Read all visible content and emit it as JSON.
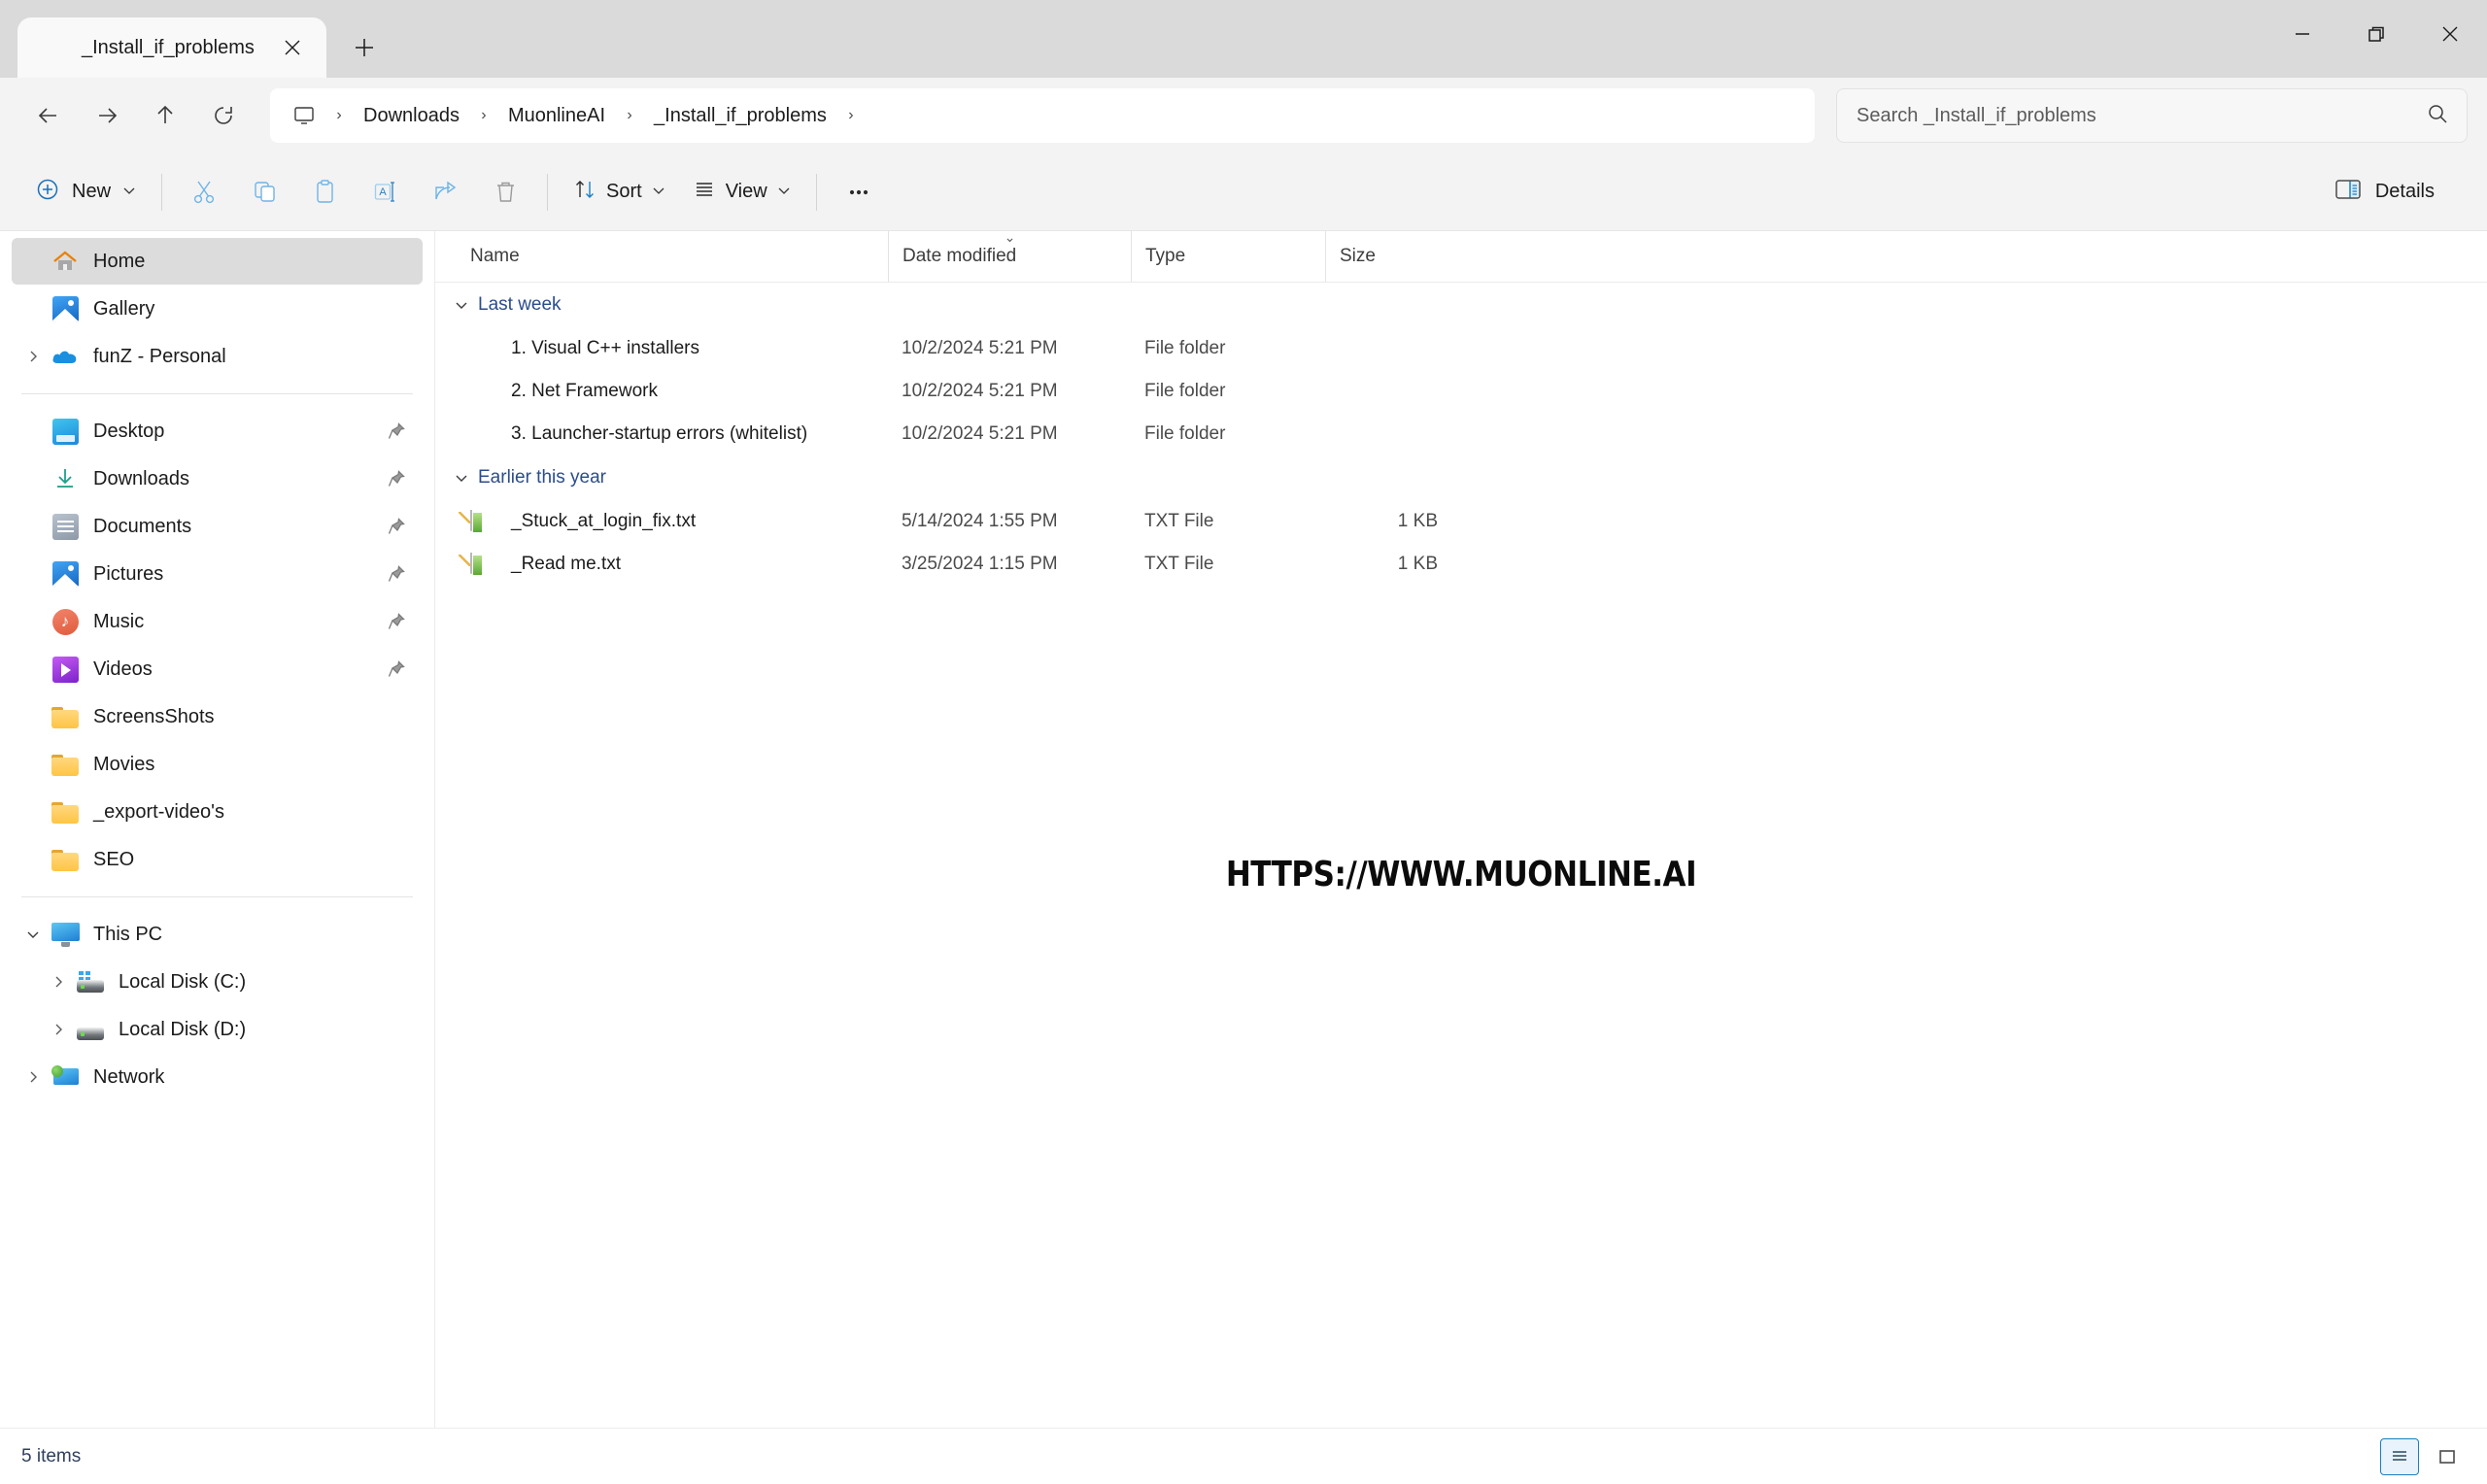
{
  "window": {
    "tab_title": "_Install_if_problems",
    "tab_icon": "folder-icon",
    "close_tab_icon": "close-icon",
    "new_tab_icon": "plus-icon",
    "minimize_icon": "minimize-icon",
    "restore_icon": "restore-icon",
    "close_icon": "close-icon"
  },
  "navbar": {
    "back_icon": "back-arrow-icon",
    "forward_icon": "forward-arrow-icon",
    "up_icon": "up-arrow-icon",
    "refresh_icon": "refresh-icon",
    "breadcrumb_root_icon": "this-pc-icon",
    "breadcrumbs": [
      {
        "label": "Downloads"
      },
      {
        "label": "MuonlineAI"
      },
      {
        "label": "_Install_if_problems"
      }
    ],
    "separator": "›",
    "search": {
      "placeholder": "Search _Install_if_problems",
      "value": "",
      "icon": "search-icon"
    }
  },
  "commandbar": {
    "new_label": "New",
    "new_icon": "plus-circle-icon",
    "dropdown_chevron": "⌄",
    "icons": [
      {
        "name": "cut-icon"
      },
      {
        "name": "copy-icon"
      },
      {
        "name": "paste-icon"
      },
      {
        "name": "rename-icon"
      },
      {
        "name": "share-icon"
      },
      {
        "name": "delete-icon"
      }
    ],
    "sort_label": "Sort",
    "sort_icon": "sort-arrows-icon",
    "view_label": "View",
    "view_icon": "view-lines-icon",
    "more_label": "•••",
    "more_icon": "ellipsis-icon",
    "details_label": "Details",
    "details_icon": "details-pane-icon"
  },
  "sidebar": {
    "groups": [
      {
        "items": [
          {
            "label": "Home",
            "icon": "home-icon",
            "selected": true,
            "expander": false,
            "pinned": false
          },
          {
            "label": "Gallery",
            "icon": "gallery-icon",
            "selected": false,
            "expander": false,
            "pinned": false
          },
          {
            "label": "funZ - Personal",
            "icon": "onedrive-icon",
            "selected": false,
            "expander": true,
            "pinned": false
          }
        ]
      },
      {
        "items": [
          {
            "label": "Desktop",
            "icon": "desktop-icon",
            "selected": false,
            "expander": false,
            "pinned": true
          },
          {
            "label": "Downloads",
            "icon": "downloads-icon",
            "selected": false,
            "expander": false,
            "pinned": true
          },
          {
            "label": "Documents",
            "icon": "documents-icon",
            "selected": false,
            "expander": false,
            "pinned": true
          },
          {
            "label": "Pictures",
            "icon": "pictures-icon",
            "selected": false,
            "expander": false,
            "pinned": true
          },
          {
            "label": "Music",
            "icon": "music-icon",
            "selected": false,
            "expander": false,
            "pinned": true
          },
          {
            "label": "Videos",
            "icon": "videos-icon",
            "selected": false,
            "expander": false,
            "pinned": true
          },
          {
            "label": "ScreensShots",
            "icon": "folder-icon",
            "selected": false,
            "expander": false,
            "pinned": false
          },
          {
            "label": "Movies",
            "icon": "folder-icon",
            "selected": false,
            "expander": false,
            "pinned": false
          },
          {
            "label": "_export-video's",
            "icon": "folder-icon",
            "selected": false,
            "expander": false,
            "pinned": false
          },
          {
            "label": "SEO",
            "icon": "folder-icon",
            "selected": false,
            "expander": false,
            "pinned": false
          }
        ]
      },
      {
        "items": [
          {
            "label": "This PC",
            "icon": "this-pc-icon",
            "selected": false,
            "expander": true,
            "expanded": true,
            "pinned": false
          },
          {
            "label": "Local Disk (C:)",
            "icon": "disk-windows-icon",
            "selected": false,
            "expander": true,
            "indent": true,
            "pinned": false
          },
          {
            "label": "Local Disk (D:)",
            "icon": "disk-icon",
            "selected": false,
            "expander": true,
            "indent": true,
            "pinned": false
          },
          {
            "label": "Network",
            "icon": "network-icon",
            "selected": false,
            "expander": true,
            "pinned": false
          }
        ]
      }
    ],
    "pin_icon": "pin-icon"
  },
  "filelist": {
    "columns": {
      "name": "Name",
      "date_modified": "Date modified",
      "type": "Type",
      "size": "Size"
    },
    "sorted_column": "date_modified",
    "sort_caret": "⌄",
    "group_chevron": "⌄",
    "groups": [
      {
        "label": "Last week",
        "rows": [
          {
            "name": "1. Visual C++ installers",
            "date": "10/2/2024 5:21 PM",
            "type": "File folder",
            "size": "",
            "icon": "folder-icon"
          },
          {
            "name": "2. Net Framework",
            "date": "10/2/2024 5:21 PM",
            "type": "File folder",
            "size": "",
            "icon": "folder-icon"
          },
          {
            "name": "3. Launcher-startup errors (whitelist)",
            "date": "10/2/2024 5:21 PM",
            "type": "File folder",
            "size": "",
            "icon": "folder-icon"
          }
        ]
      },
      {
        "label": "Earlier this year",
        "rows": [
          {
            "name": "_Stuck_at_login_fix.txt",
            "date": "5/14/2024 1:55 PM",
            "type": "TXT File",
            "size": "1 KB",
            "icon": "text-file-icon"
          },
          {
            "name": "_Read me.txt",
            "date": "3/25/2024 1:15 PM",
            "type": "TXT File",
            "size": "1 KB",
            "icon": "text-file-icon"
          }
        ]
      }
    ],
    "watermark": "HTTPS://WWW.MUONLINE.AI"
  },
  "statusbar": {
    "items_count": "5 items",
    "details_view_icon": "details-view-icon",
    "large_icons_view_icon": "large-icons-view-icon"
  },
  "colors": {
    "accent": "#1a7fc1",
    "group_header": "#2c4c8c",
    "titlebar_bg": "#dadada",
    "toolbar_bg": "#f3f3f3",
    "selection_bg": "#dcdcdc",
    "folder_yellow": "#ffc544"
  }
}
